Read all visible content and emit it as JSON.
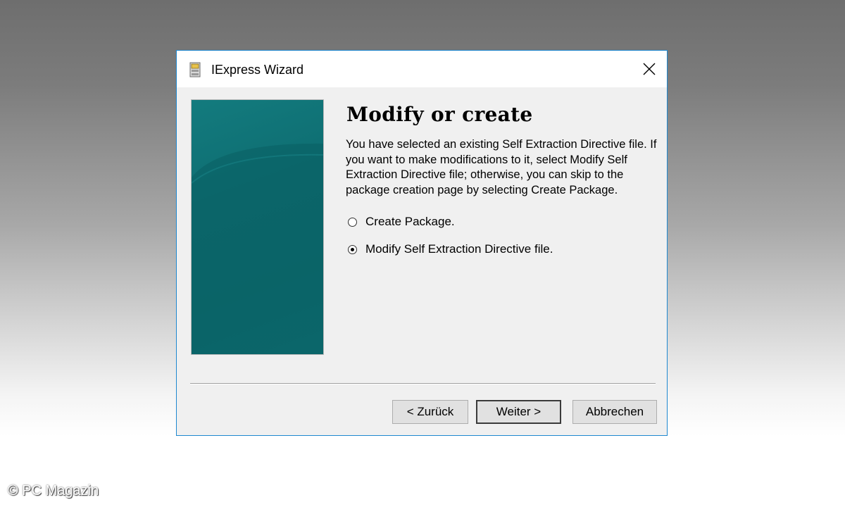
{
  "window": {
    "title": "IExpress Wizard",
    "close_label": "✕"
  },
  "page": {
    "heading": "Modify or create",
    "description": "You have selected an existing Self Extraction Directive file. If you want to make modifications to it, select Modify Self Extraction Directive file; otherwise, you can skip to the package creation page by selecting Create Package."
  },
  "options": [
    {
      "label": "Create Package.",
      "checked": false
    },
    {
      "label": "Modify Self Extraction Directive file.",
      "checked": true
    }
  ],
  "buttons": {
    "back": "< Zurück",
    "next": "Weiter >",
    "cancel": "Abbrechen"
  },
  "watermark": "© PC Magazin",
  "colors": {
    "accent_border": "#1e88d0",
    "banner_teal": "#0e6e72"
  }
}
